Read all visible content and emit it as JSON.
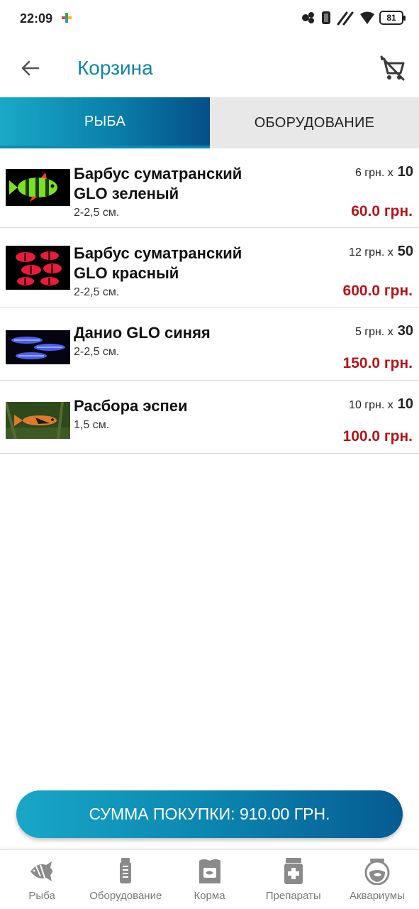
{
  "status_bar": {
    "time": "22:09",
    "battery": "81"
  },
  "header": {
    "title": "Корзина",
    "back_icon": "arrow-left-icon",
    "clear_cart_icon": "remove-cart-icon"
  },
  "tabs": [
    {
      "label": "РЫБА",
      "active": true
    },
    {
      "label": "ОБОРУДОВАНИЕ",
      "active": false
    }
  ],
  "cart_items": [
    {
      "name_line1": "Барбус суматранский",
      "name_line2": "GLO зеленый",
      "size": "2-2,5 см.",
      "unit_price": "6 грн. x",
      "quantity": "10",
      "total": "60.0 грн."
    },
    {
      "name_line1": "Барбус суматранский",
      "name_line2": "GLO красный",
      "size": "2-2,5 см.",
      "unit_price": "12 грн. x",
      "quantity": "50",
      "total": "600.0 грн."
    },
    {
      "name_line1": "Данио GLO синяя",
      "name_line2": "",
      "size": "2-2,5 см.",
      "unit_price": "5 грн. x",
      "quantity": "30",
      "total": "150.0 грн."
    },
    {
      "name_line1": "Расбора эспеи",
      "name_line2": "",
      "size": "1,5 см.",
      "unit_price": "10 грн. x",
      "quantity": "10",
      "total": "100.0 грн."
    }
  ],
  "summary": {
    "total_label": "СУММА ПОКУПКИ: 910.00 ГРН."
  },
  "bottom_nav": [
    {
      "label": "Рыба",
      "icon": "fish-icon"
    },
    {
      "label": "Оборудование",
      "icon": "filter-icon"
    },
    {
      "label": "Корма",
      "icon": "food-bag-icon"
    },
    {
      "label": "Препараты",
      "icon": "medicine-jar-icon"
    },
    {
      "label": "Аквариумы",
      "icon": "fishbowl-icon"
    }
  ],
  "colors": {
    "accent": "#0d86a8",
    "price_red": "#b3151b",
    "tab_inactive": "#e8e8e8"
  }
}
